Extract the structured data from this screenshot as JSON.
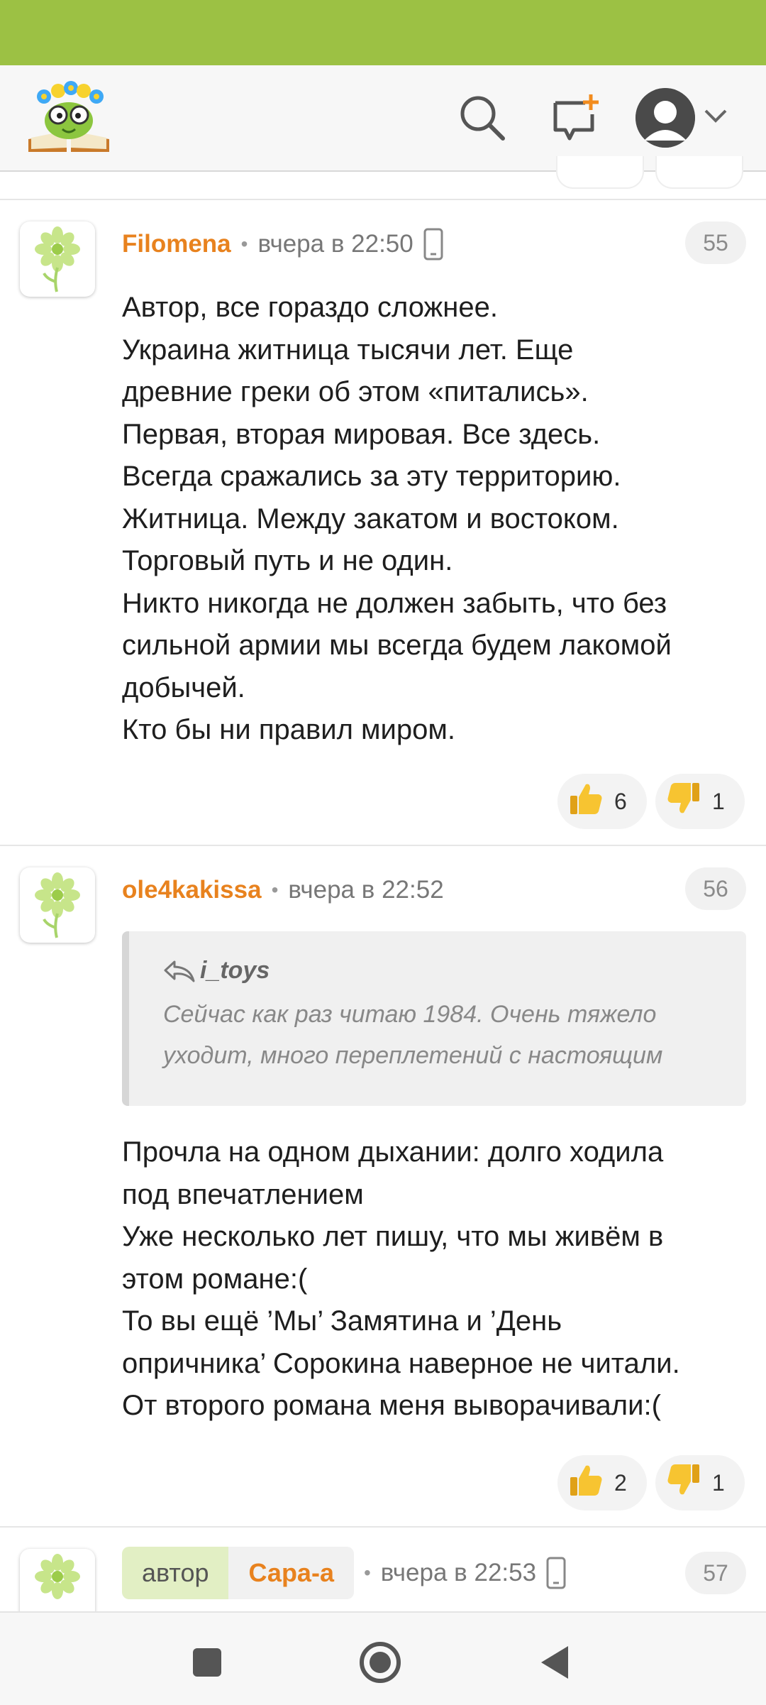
{
  "header": {
    "logo_name": "site-logo",
    "icons": [
      "search-icon",
      "new-post-icon",
      "avatar-icon",
      "chevron-down-icon"
    ]
  },
  "comments": [
    {
      "author": "Filomena",
      "time": "вчера в 22:50",
      "number": "55",
      "device": "phone-icon",
      "lines": [
        "Автор, все гораздо сложнее.",
        "Украина житница тысячи лет. Еще",
        "древние греки об этом «питались».",
        "Первая, вторая мировая. Все здесь.",
        "Всегда сражались за эту территорию.",
        "Житница. Между закатом и востоком.",
        "Торговый путь и не один.",
        "Никто никогда не должен забыть, что без",
        "сильной армии мы всегда будем лакомой",
        "добычей.",
        "Кто бы ни правил миром."
      ],
      "likes": "6",
      "dislikes": "1"
    },
    {
      "author": "ole4kakissa",
      "time": "вчера в 22:52",
      "number": "56",
      "quote": {
        "author": "i_toys",
        "lines": [
          "Сейчас как раз читаю 1984. Очень тяжело",
          "уходит, много переплетений с настоящим"
        ]
      },
      "lines": [
        "Прочла на одном дыхании: долго ходила",
        "под впечатлением",
        "Уже несколько лет пишу, что мы живём в",
        "этом романе:(",
        "То вы ещё ’Мы’ Замятина и ’День",
        "опричника’ Сорокина наверное не читали.",
        "От второго романа меня выворачивали:("
      ],
      "likes": "2",
      "dislikes": "1"
    },
    {
      "tag": "автор",
      "author": "Сара-а",
      "time": "вчера в 22:53",
      "number": "57",
      "device": "phone-icon"
    }
  ],
  "colors": {
    "status_bar": "#9cc144",
    "author": "#e8821e",
    "author_tag_bg": "#e2efc4"
  },
  "nav": [
    "recent-apps-button",
    "home-button",
    "back-button"
  ]
}
